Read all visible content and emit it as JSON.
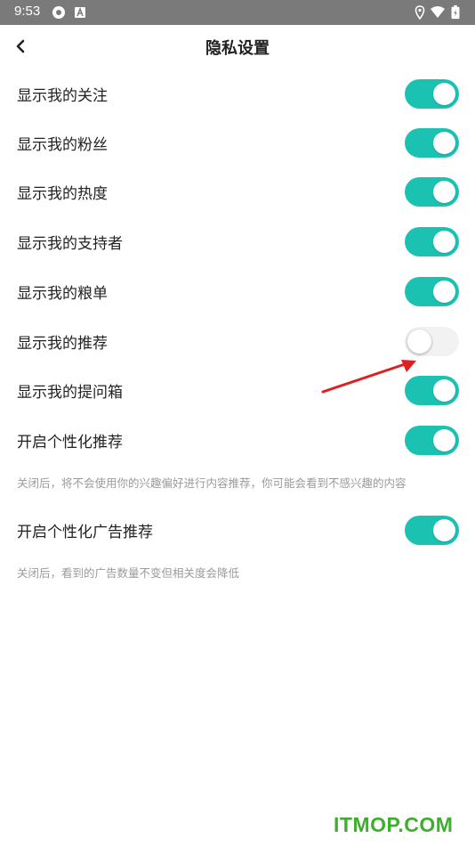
{
  "status_bar": {
    "time": "9:53"
  },
  "header": {
    "title": "隐私设置"
  },
  "settings": [
    {
      "label": "显示我的关注",
      "enabled": true
    },
    {
      "label": "显示我的粉丝",
      "enabled": true
    },
    {
      "label": "显示我的热度",
      "enabled": true
    },
    {
      "label": "显示我的支持者",
      "enabled": true
    },
    {
      "label": "显示我的粮单",
      "enabled": true
    },
    {
      "label": "显示我的推荐",
      "enabled": false
    },
    {
      "label": "显示我的提问箱",
      "enabled": true
    },
    {
      "label": "开启个性化推荐",
      "enabled": true,
      "note": "关闭后，将不会使用你的兴趣偏好进行内容推荐，你可能会看到不感兴趣的内容"
    },
    {
      "label": "开启个性化广告推荐",
      "enabled": true,
      "note": "关闭后，看到的广告数量不变但相关度会降低"
    }
  ],
  "colors": {
    "toggle_on": "#1bc2b2",
    "toggle_off": "#f2f2f2",
    "annotation_arrow": "#e02020"
  },
  "watermark": "ITMOP.COM"
}
